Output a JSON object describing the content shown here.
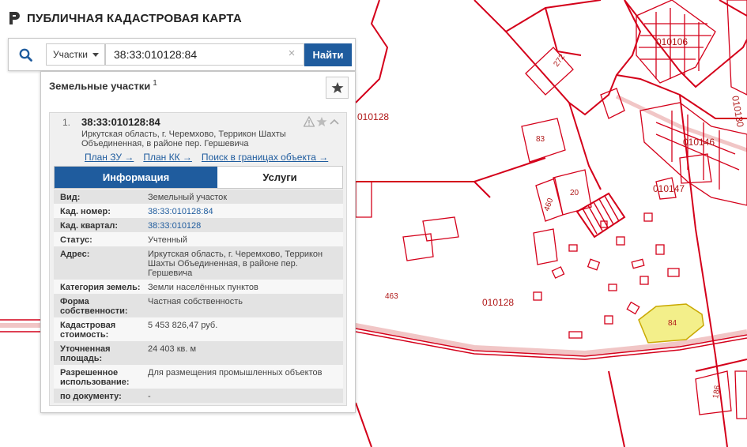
{
  "app": {
    "title": "ПУБЛИЧНАЯ КАДАСТРОВАЯ КАРТА"
  },
  "search": {
    "type_selected": "Участки",
    "query": "38:33:010128:84",
    "find_label": "Найти",
    "clear_symbol": "×"
  },
  "panel": {
    "title": "Земельные участки",
    "count": "1",
    "result": {
      "index": "1.",
      "cad_number": "38:33:010128:84",
      "address": "Иркутская область, г. Черемхово, Террикон Шахты Объединенная, в районе пер. Гершевича",
      "links": [
        "План ЗУ →",
        "План КК →",
        "Поиск в границах объекта →"
      ],
      "tabs": [
        {
          "label": "Информация",
          "active": true
        },
        {
          "label": "Услуги",
          "active": false
        }
      ],
      "properties": [
        {
          "label": "Вид:",
          "value": "Земельный участок"
        },
        {
          "label": "Кад. номер:",
          "value": "38:33:010128:84"
        },
        {
          "label": "Кад. квартал:",
          "value": "38:33:010128"
        },
        {
          "label": "Статус:",
          "value": "Учтенный"
        },
        {
          "label": "Адрес:",
          "value": "Иркутская область, г. Черемхово, Террикон Шахты Объединенная, в районе пер. Гершевича"
        },
        {
          "label": "Категория земель:",
          "value": "Земли населённых пунктов"
        },
        {
          "label": "Форма собственности:",
          "value": "Частная собственность"
        },
        {
          "label": "Кадастровая стоимость:",
          "value": "5 453 826,47 руб."
        },
        {
          "label": "Уточненная площадь:",
          "value": "24 403 кв. м"
        },
        {
          "label": "Разрешенное использование:",
          "value": "Для размещения промышленных объектов"
        },
        {
          "label": "по документу:",
          "value": "-"
        }
      ]
    }
  },
  "map": {
    "labels": [
      "010106",
      "010130",
      "010146",
      "010147",
      "010128",
      "010128",
      "272",
      "83",
      "20",
      "460",
      "463",
      "84",
      "186"
    ],
    "colors": {
      "boundary": "#d4001a",
      "highlight_fill": "#f3ef8a",
      "road": "#e9a9a9"
    }
  }
}
